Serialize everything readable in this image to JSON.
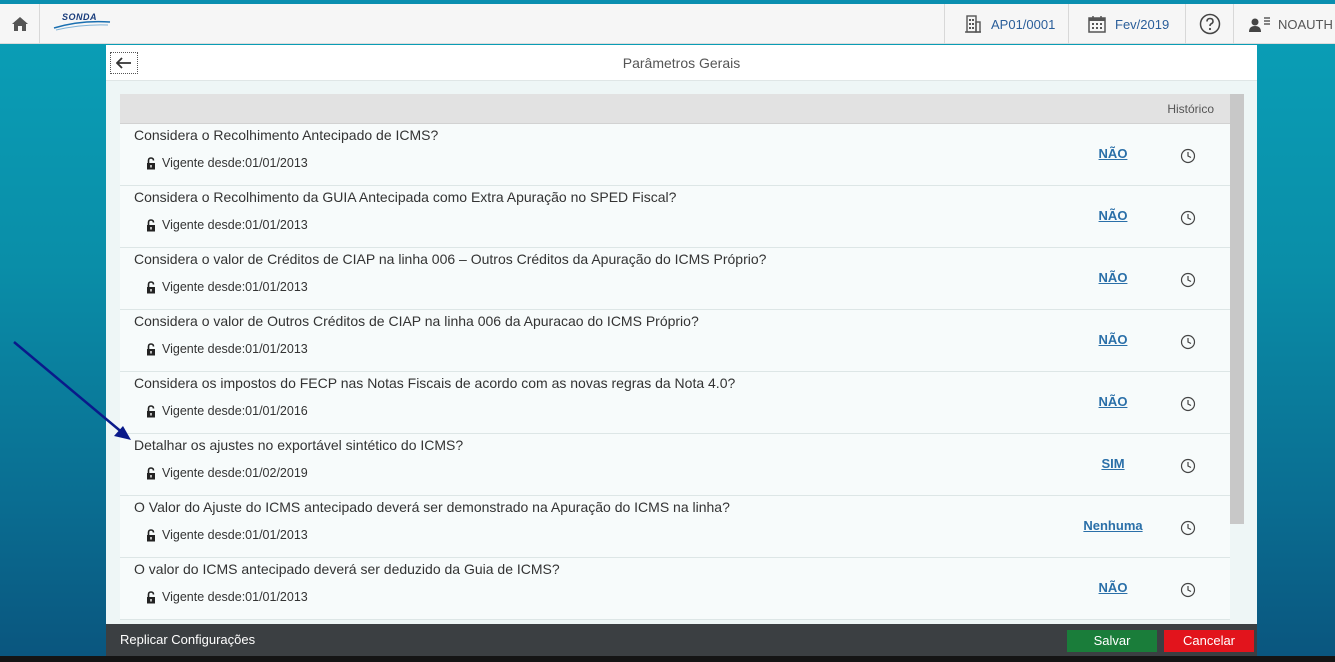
{
  "header": {
    "brand": "SONDA",
    "company": "AP01/0001",
    "period": "Fev/2019",
    "user": "NOAUTH"
  },
  "panel": {
    "title": "Parâmetros Gerais",
    "history_header": "Histórico"
  },
  "rows": [
    {
      "question": "Considera o Recolhimento Antecipado de ICMS?",
      "since": "Vigente desde:01/01/2013",
      "value": "NÃO"
    },
    {
      "question": "Considera o Recolhimento da GUIA Antecipada como Extra Apuração no SPED Fiscal?",
      "since": "Vigente desde:01/01/2013",
      "value": "NÃO"
    },
    {
      "question": "Considera o valor de Créditos de CIAP na linha 006 – Outros Créditos da Apuração do ICMS Próprio?",
      "since": "Vigente desde:01/01/2013",
      "value": "NÃO"
    },
    {
      "question": "Considera o valor de Outros Créditos de CIAP na linha 006 da Apuracao do ICMS Próprio?",
      "since": "Vigente desde:01/01/2013",
      "value": "NÃO"
    },
    {
      "question": "Considera os impostos do FECP nas Notas Fiscais de acordo com as novas regras da Nota 4.0?",
      "since": "Vigente desde:01/01/2016",
      "value": "NÃO"
    },
    {
      "question": "Detalhar os ajustes no exportável sintético do ICMS?",
      "since": "Vigente desde:01/02/2019",
      "value": "SIM"
    },
    {
      "question": "O Valor do Ajuste do ICMS antecipado deverá ser demonstrado na Apuração do ICMS na linha?",
      "since": "Vigente desde:01/01/2013",
      "value": "Nenhuma"
    },
    {
      "question": "O valor do ICMS antecipado deverá ser deduzido da Guia de ICMS?",
      "since": "Vigente desde:01/01/2013",
      "value": "NÃO"
    }
  ],
  "footer": {
    "replicate": "Replicar Configurações",
    "save": "Salvar",
    "cancel": "Cancelar"
  },
  "colors": {
    "accent": "#2a6fa8",
    "save": "#1a7d3a",
    "cancel": "#e2141c",
    "annotation_arrow": "#0a1a8a"
  },
  "icons": {
    "home": "home-icon",
    "company": "building-icon",
    "period": "calendar-icon",
    "help": "help-icon",
    "user": "user-menu-icon",
    "back": "back-arrow-icon",
    "lock": "unlock-icon",
    "history": "clock-icon"
  }
}
